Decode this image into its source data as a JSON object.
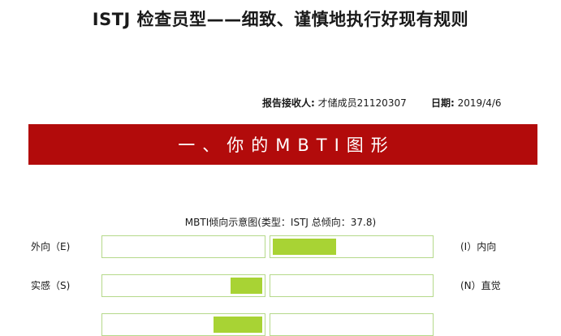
{
  "header": {
    "title": "ISTJ 检查员型——细致、谨慎地执行好现有规则",
    "recipient_label": "报告接收人:",
    "recipient_value": "才储成员21120307",
    "date_label": "日期:",
    "date_value": "2019/4/6"
  },
  "section": {
    "heading": "一、你的MBTI图形"
  },
  "colors": {
    "banner": "#b20b0b",
    "bar_fill": "#a8d334",
    "bar_border": "#b5d98a"
  },
  "chart_data": {
    "type": "bar",
    "title": "MBTI倾向示意图(类型：ISTJ 总倾向：37.8)",
    "rows": [
      {
        "left_label": "外向（E)",
        "right_label": "(I）内向",
        "side": "right",
        "fraction": 0.4
      },
      {
        "left_label": "实感（S)",
        "right_label": "(N）直觉",
        "side": "left",
        "fraction": 0.2
      },
      {
        "left_label": "",
        "right_label": "",
        "side": "left",
        "fraction": 0.31
      }
    ]
  }
}
